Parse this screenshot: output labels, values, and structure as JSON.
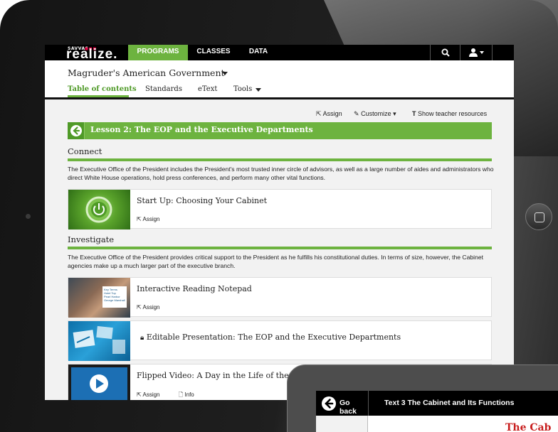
{
  "app": {
    "logo_small": "SAVVAS",
    "logo_big": "realize."
  },
  "topnav": {
    "items": [
      {
        "label": "PROGRAMS",
        "active": true
      },
      {
        "label": "CLASSES",
        "active": false
      },
      {
        "label": "DATA",
        "active": false
      }
    ]
  },
  "header": {
    "course_title": "Magruder's American Government",
    "tabs": [
      {
        "label": "Table of contents",
        "active": true
      },
      {
        "label": "Standards",
        "active": false
      },
      {
        "label": "eText",
        "active": false
      },
      {
        "label": "Tools",
        "active": false
      }
    ]
  },
  "toolbar": {
    "assign": "Assign",
    "customize": "Customize",
    "teacher_resources": "Show teacher resources"
  },
  "lesson": {
    "title": "Lesson 2: The EOP and the Executive Departments"
  },
  "sections": [
    {
      "title": "Connect",
      "description": "The Executive Office of the President includes the President's most trusted inner circle of advisors, as well as a large number of aides and administrators who direct White House operations, hold press conferences, and perform many other vital functions."
    },
    {
      "title": "Investigate",
      "description": "The Executive Office of the President provides critical support to the President as he fulfills his constitutional duties. In terms of size, however, the Cabinet agencies make up a much larger part of the executive branch."
    }
  ],
  "items": [
    {
      "title": "Start Up: Choosing Your Cabinet",
      "assign": "Assign"
    },
    {
      "title": "Interactive Reading Notepad",
      "assign": "Assign",
      "thumb_text": "Key Terms\nHotel Top\nPearl Harbor\nGeorge Marshall"
    },
    {
      "title": "Editable Presentation: The EOP and the Executive Departments",
      "locked": true
    },
    {
      "title": "Flipped Video: A Day in the Life of the W",
      "assign": "Assign",
      "info": "Info"
    }
  ],
  "second_screen": {
    "back_label": "Go back",
    "title": "Text 3 The Cabinet and Its Functions",
    "partial_heading": "The Cab"
  },
  "colors": {
    "accent_green": "#6db33f",
    "dark_green": "#4f9a27",
    "topbar": "#000000",
    "red_heading": "#c81e1e"
  }
}
